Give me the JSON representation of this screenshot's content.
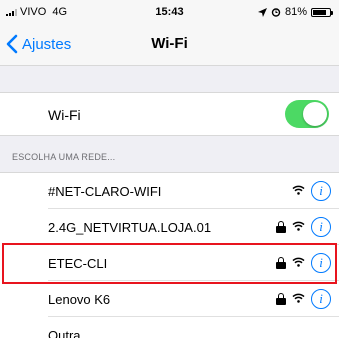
{
  "status_bar": {
    "carrier": "VIVO",
    "network": "4G",
    "time": "15:43",
    "battery_percent": "81%",
    "battery_level": 0.81
  },
  "nav": {
    "back_label": "Ajustes",
    "title": "Wi-Fi"
  },
  "wifi_toggle": {
    "label": "Wi-Fi",
    "on": true
  },
  "section_header": "ESCOLHA UMA REDE...",
  "networks": [
    {
      "name": "#NET-CLARO-WIFI",
      "locked": false
    },
    {
      "name": "2.4G_NETVIRTUA.LOJA.01",
      "locked": true
    },
    {
      "name": "ETEC-CLI",
      "locked": true,
      "highlighted": true
    },
    {
      "name": "Lenovo K6",
      "locked": true
    },
    {
      "name": "Outra...",
      "locked": false
    }
  ],
  "colors": {
    "accent": "#007aff",
    "toggle_on": "#4cd964",
    "highlight_border": "#e8141e"
  }
}
